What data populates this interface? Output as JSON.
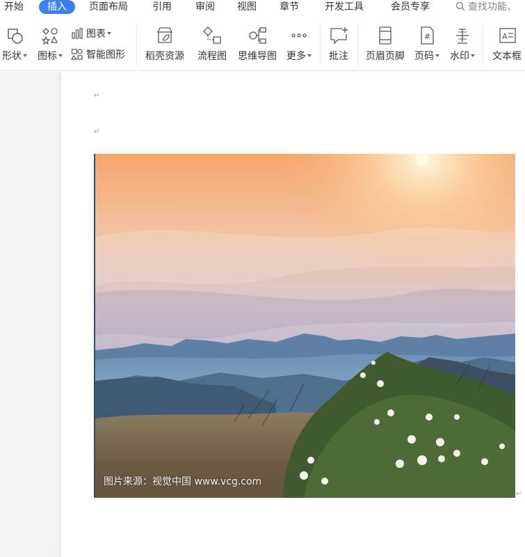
{
  "menu": {
    "tabs": [
      {
        "label": "开始"
      },
      {
        "label": "插入"
      },
      {
        "label": "页面布局"
      },
      {
        "label": "引用"
      },
      {
        "label": "审阅"
      },
      {
        "label": "视图"
      },
      {
        "label": "章节"
      },
      {
        "label": "开发工具"
      },
      {
        "label": "会员专享"
      }
    ],
    "active_tab": "插入",
    "search_placeholder": "查找功能、"
  },
  "ribbon": {
    "shape": "形状",
    "icon": "图标",
    "chart": "图表",
    "smart_art": "智能图形",
    "docer_resources": "稻壳资源",
    "flowchart": "流程图",
    "mind_map": "思维导图",
    "more": "更多",
    "comment": "批注",
    "header_footer": "页眉页脚",
    "page_number": "页码",
    "watermark": "水印",
    "text_box": "文本框"
  },
  "document": {
    "image_caption": "图片来源：视觉中国 www.vcg.com",
    "paragraph_mark": "↵"
  },
  "colors": {
    "accent": "#3c7fe8"
  }
}
